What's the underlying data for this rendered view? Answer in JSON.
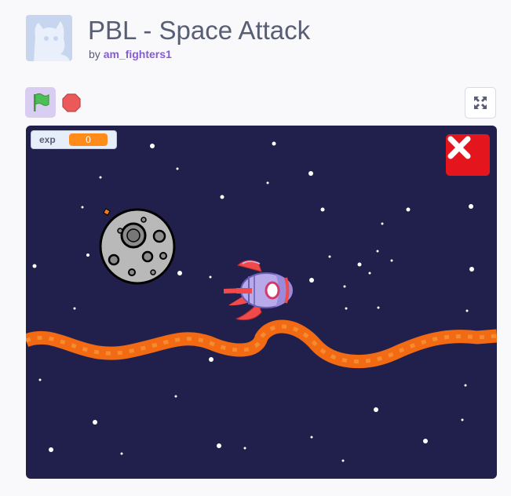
{
  "project": {
    "title": "PBL - Space Attack",
    "by_label": "by",
    "author": "am_fighters1"
  },
  "controls": {
    "green_flag_icon": "green-flag-icon",
    "stop_icon": "stop-sign-icon",
    "fullscreen_icon": "fullscreen-icon"
  },
  "stage": {
    "background_color": "#21204c",
    "variable_monitor": {
      "label": "exp",
      "value": "0"
    },
    "sprites": [
      "moon-asteroid",
      "rocket-ship",
      "lava-wave",
      "close-x-button"
    ]
  },
  "colors": {
    "accent": "#855cd6",
    "monitor_orange": "#ff8c1a",
    "close_red": "#e4151d",
    "lava": "#f26a14"
  }
}
